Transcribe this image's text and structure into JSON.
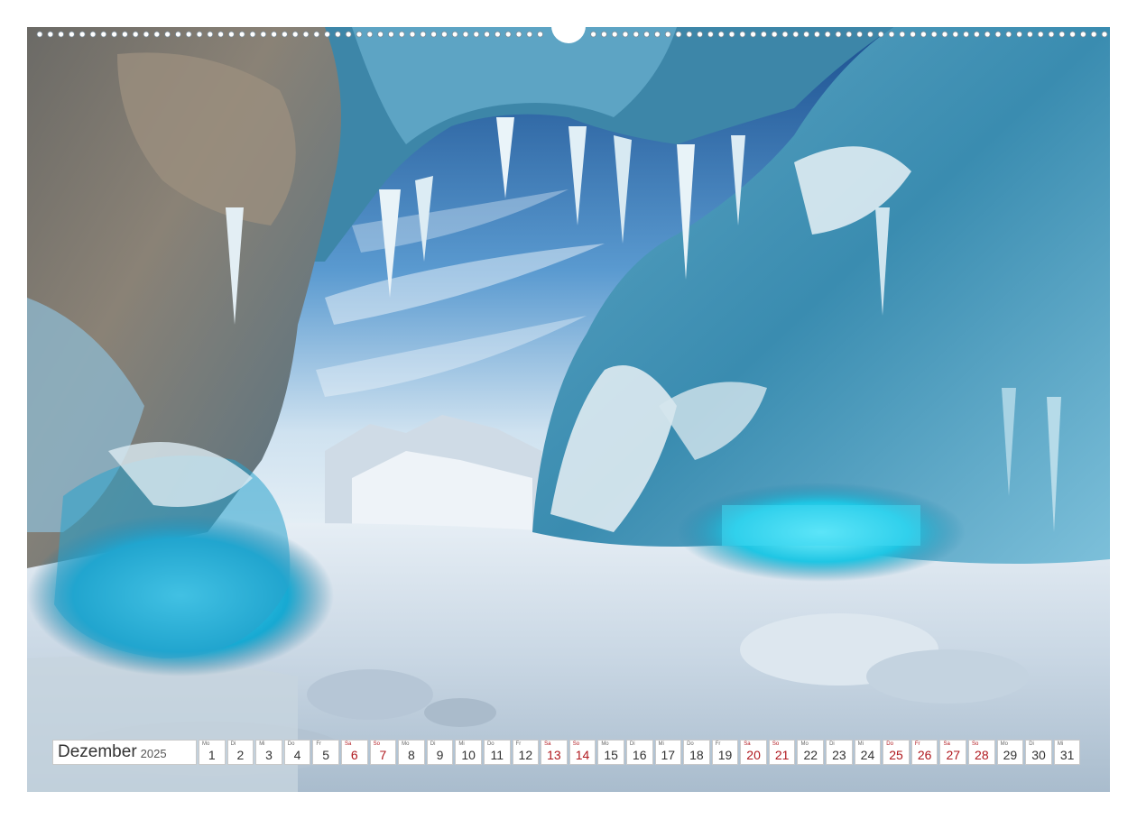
{
  "calendar": {
    "month": "Dezember",
    "year": "2025",
    "days": [
      {
        "wd": "Mo",
        "d": "1",
        "we": false
      },
      {
        "wd": "Di",
        "d": "2",
        "we": false
      },
      {
        "wd": "Mi",
        "d": "3",
        "we": false
      },
      {
        "wd": "Do",
        "d": "4",
        "we": false
      },
      {
        "wd": "Fr",
        "d": "5",
        "we": false
      },
      {
        "wd": "Sa",
        "d": "6",
        "we": true
      },
      {
        "wd": "So",
        "d": "7",
        "we": true
      },
      {
        "wd": "Mo",
        "d": "8",
        "we": false
      },
      {
        "wd": "Di",
        "d": "9",
        "we": false
      },
      {
        "wd": "Mi",
        "d": "10",
        "we": false
      },
      {
        "wd": "Do",
        "d": "11",
        "we": false
      },
      {
        "wd": "Fr",
        "d": "12",
        "we": false
      },
      {
        "wd": "Sa",
        "d": "13",
        "we": true
      },
      {
        "wd": "So",
        "d": "14",
        "we": true
      },
      {
        "wd": "Mo",
        "d": "15",
        "we": false
      },
      {
        "wd": "Di",
        "d": "16",
        "we": false
      },
      {
        "wd": "Mi",
        "d": "17",
        "we": false
      },
      {
        "wd": "Do",
        "d": "18",
        "we": false
      },
      {
        "wd": "Fr",
        "d": "19",
        "we": false
      },
      {
        "wd": "Sa",
        "d": "20",
        "we": true
      },
      {
        "wd": "So",
        "d": "21",
        "we": true
      },
      {
        "wd": "Mo",
        "d": "22",
        "we": false
      },
      {
        "wd": "Di",
        "d": "23",
        "we": false
      },
      {
        "wd": "Mi",
        "d": "24",
        "we": false
      },
      {
        "wd": "Do",
        "d": "25",
        "we": true
      },
      {
        "wd": "Fr",
        "d": "26",
        "we": true
      },
      {
        "wd": "Sa",
        "d": "27",
        "we": true
      },
      {
        "wd": "So",
        "d": "28",
        "we": true
      },
      {
        "wd": "Mo",
        "d": "29",
        "we": false
      },
      {
        "wd": "Di",
        "d": "30",
        "we": false
      },
      {
        "wd": "Mi",
        "d": "31",
        "we": false
      }
    ]
  },
  "colors": {
    "weekend": "#b0181e",
    "text": "#333333",
    "ice": "#2bb8d8",
    "sky": "#3a78b8",
    "snow": "#e8eef4"
  }
}
